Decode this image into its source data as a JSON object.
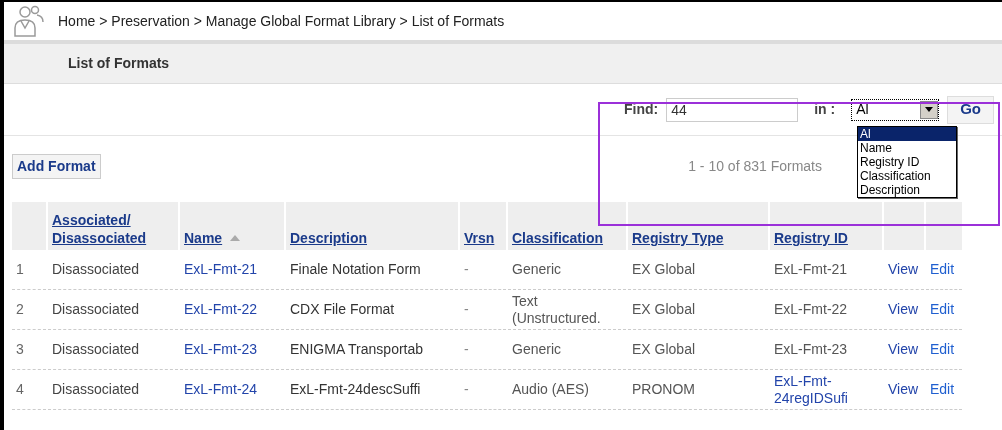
{
  "breadcrumb": "Home > Preservation > Manage Global Format Library > List of Formats",
  "page_title": "List of Formats",
  "search": {
    "label": "Find:",
    "value": "44",
    "in_label": "in :",
    "scope": "Al",
    "go": "Go",
    "options": [
      {
        "label": "Al",
        "selected": true
      },
      {
        "label": "Name",
        "selected": false
      },
      {
        "label": "Registry ID",
        "selected": false
      },
      {
        "label": "Classification",
        "selected": false
      },
      {
        "label": "Description",
        "selected": false
      }
    ]
  },
  "add_button": "Add Format",
  "count": "1 - 10 of 831 Formats",
  "table": {
    "columns": [
      {
        "sorted": false
      },
      {
        "label": "Associated/ Disassociated",
        "sorted": false
      },
      {
        "label": "Name",
        "sorted": true
      },
      {
        "label": "Description",
        "sorted": false
      },
      {
        "label": "Vrsn",
        "sorted": false
      },
      {
        "label": "Classification",
        "sorted": false
      },
      {
        "label": "Registry Type",
        "sorted": false
      },
      {
        "label": "Registry ID",
        "sorted": false
      },
      {
        "sorted": false
      },
      {
        "sorted": false
      }
    ],
    "rows": [
      {
        "index": "1",
        "status": "Disassociated",
        "name": "ExL-Fmt-21",
        "description": "Finale Notation Form",
        "version": "-",
        "classification": "Generic",
        "registry_type": "EX Global",
        "registry_id": "ExL-Fmt-21",
        "registry_id_link": false,
        "view": "View",
        "edit": "Edit"
      },
      {
        "index": "2",
        "status": "Disassociated",
        "name": "ExL-Fmt-22",
        "description": "CDX File Format",
        "version": "-",
        "classification": "Text (Unstructured.",
        "registry_type": "EX Global",
        "registry_id": "ExL-Fmt-22",
        "registry_id_link": false,
        "view": "View",
        "edit": "Edit"
      },
      {
        "index": "3",
        "status": "Disassociated",
        "name": "ExL-Fmt-23",
        "description": "ENIGMA Transportab",
        "version": "-",
        "classification": "Generic",
        "registry_type": "EX Global",
        "registry_id": "ExL-Fmt-23",
        "registry_id_link": false,
        "view": "View",
        "edit": "Edit"
      },
      {
        "index": "4",
        "status": "Disassociated",
        "name": "ExL-Fmt-24",
        "description": "ExL-Fmt-24descSuffi",
        "version": "-",
        "classification": "Audio (AES)",
        "registry_type": "PRONOM",
        "registry_id": "ExL-Fmt-24regIDSufi",
        "registry_id_link": true,
        "view": "View",
        "edit": "Edit"
      }
    ]
  }
}
